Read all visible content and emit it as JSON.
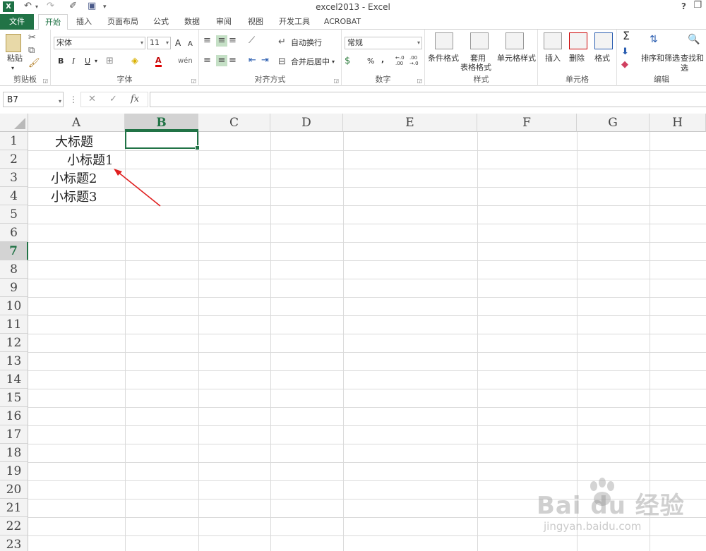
{
  "window": {
    "title": "excel2013 - Excel",
    "app_logo": "X",
    "help": "?",
    "restore": "❐"
  },
  "tabs": [
    "文件",
    "开始",
    "插入",
    "页面布局",
    "公式",
    "数据",
    "审阅",
    "视图",
    "开发工具",
    "ACROBAT"
  ],
  "ribbon": {
    "clipboard": {
      "label": "剪贴板",
      "paste": "粘贴"
    },
    "font": {
      "label": "字体",
      "name": "宋体",
      "size": "11",
      "bold": "B",
      "italic": "I",
      "underline": "U",
      "grow": "A",
      "shrink": "A",
      "fontcolor": "A",
      "wen": "wén"
    },
    "alignment": {
      "label": "对齐方式",
      "wrap": "自动换行",
      "merge": "合并后居中"
    },
    "number": {
      "label": "数字",
      "format": "常规",
      "percent": "%",
      "comma": ",",
      "inc": "←.0 .00",
      "dec": ".00 →.0"
    },
    "styles": {
      "label": "样式",
      "conditional": "条件格式",
      "table1": "套用",
      "table2": "表格格式",
      "cell_styles": "单元格样式"
    },
    "cells": {
      "label": "单元格",
      "insert": "插入",
      "delete": "删除",
      "format": "格式"
    },
    "editing": {
      "label": "编辑",
      "sigma": "Σ",
      "sort": "排序和筛选",
      "find": "查找和选"
    }
  },
  "formula_bar": {
    "name_box": "B7",
    "sep": "⋮",
    "cancel": "✕",
    "enter": "✓",
    "fx": "fx",
    "value": ""
  },
  "grid": {
    "columns": [
      "A",
      "B",
      "C",
      "D",
      "E",
      "F",
      "G",
      "H"
    ],
    "rows": [
      "1",
      "2",
      "3",
      "4",
      "5",
      "6",
      "7",
      "8",
      "9",
      "10",
      "11",
      "12",
      "13",
      "14",
      "15",
      "16",
      "17",
      "18",
      "19",
      "20",
      "21",
      "22",
      "23"
    ],
    "active_col": "B",
    "active_row": "7",
    "cells": {
      "a1": "大标题",
      "a2": "小标题1",
      "a3": "小标题2",
      "a4": "小标题3"
    }
  },
  "watermark": {
    "brand": "Bai du 经验",
    "url": "jingyan.baidu.com"
  }
}
